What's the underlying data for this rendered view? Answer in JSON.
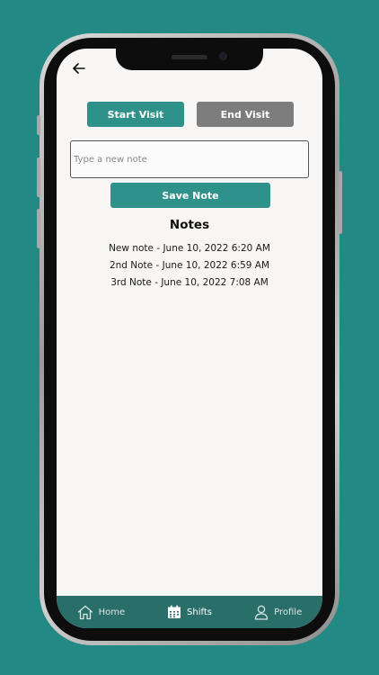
{
  "header": {
    "back_icon": "arrow-left-icon"
  },
  "visit": {
    "start_label": "Start Visit",
    "end_label": "End Visit"
  },
  "note_form": {
    "input_value": "",
    "input_placeholder": "Type a new note",
    "save_label": "Save Note"
  },
  "notes": {
    "title": "Notes",
    "items": [
      "New note - June 10, 2022 6:20 AM",
      "2nd Note - June 10, 2022 6:59 AM",
      "3rd Note - June 10, 2022 7:08 AM"
    ]
  },
  "tabbar": {
    "tabs": [
      {
        "label": "Home",
        "icon": "home-icon",
        "active": false
      },
      {
        "label": "Shifts",
        "icon": "calendar-icon",
        "active": true
      },
      {
        "label": "Profile",
        "icon": "user-icon",
        "active": false
      }
    ]
  },
  "colors": {
    "background": "#238984",
    "accent": "#2f928a",
    "secondary_button": "#7d7d7d",
    "tabbar": "#2a6e6a",
    "screen": "#f7f6f4"
  }
}
